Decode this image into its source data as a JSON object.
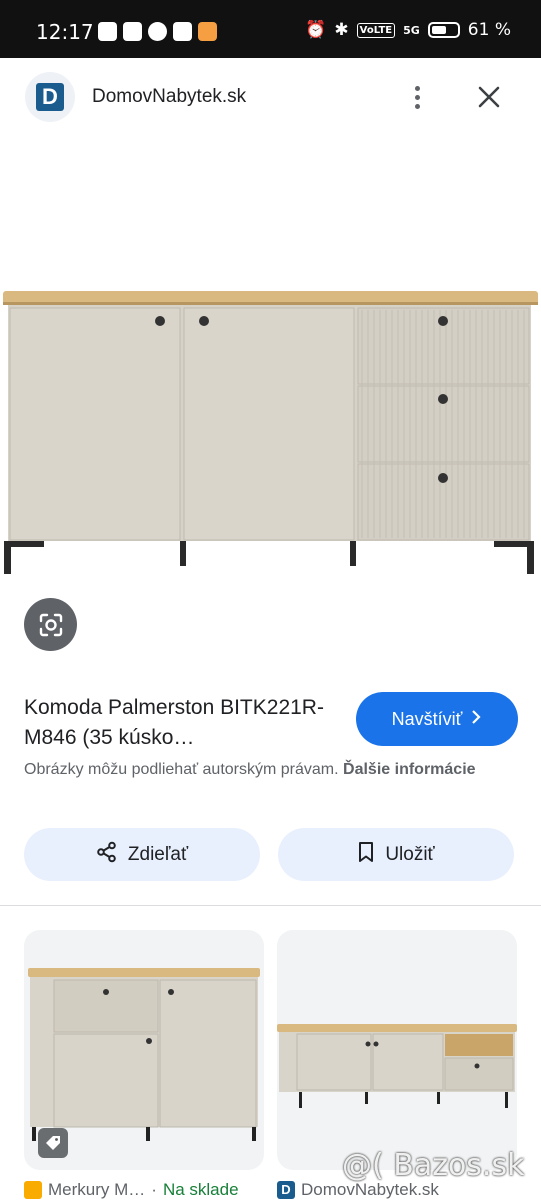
{
  "status_bar": {
    "time": "12:17",
    "battery": "61 %",
    "battery_level": 0.61,
    "volte": "VoLTE",
    "network": "5G"
  },
  "header": {
    "site_logo_letter": "D",
    "site_name": "DomovNabytek.sk",
    "more_icon": "more-vert-icon",
    "close_icon": "close-icon"
  },
  "result": {
    "title": "Komoda Palmerston BITK221R-M846 (35 kúsko…",
    "visit_label": "Navštíviť",
    "copyright_text": "Obrázky môžu podliehať autorským právam.",
    "copyright_link": "Ďalšie informácie"
  },
  "actions": {
    "share_label": "Zdieľať",
    "save_label": "Uložiť"
  },
  "related": [
    {
      "source": "Merkury M…",
      "separator": "·",
      "availability": "Na sklade",
      "logo_color": "#f9ab00"
    },
    {
      "source": "DomovNabytek.sk",
      "logo_letter": "D",
      "logo_color": "#1b5c8f"
    }
  ],
  "watermark": "@( Bazos.sk",
  "colors": {
    "accent": "#1a73e8",
    "pill_bg": "#e8f0fe",
    "in_stock": "#188038"
  }
}
